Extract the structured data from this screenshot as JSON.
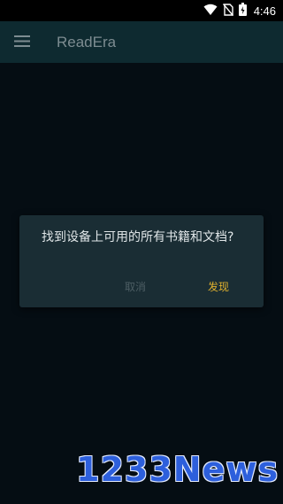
{
  "status_bar": {
    "time": "4:46",
    "icons": [
      "wifi-icon",
      "no-sim-icon",
      "battery-icon"
    ]
  },
  "app_bar": {
    "menu_icon": "hamburger-menu-icon",
    "title": "ReadEra"
  },
  "dialog": {
    "message": "找到设备上可用的所有书籍和文档?",
    "cancel_label": "取消",
    "confirm_label": "发现"
  },
  "watermark": {
    "text": "1233News"
  },
  "colors": {
    "background": "#050d13",
    "app_bar": "#0e2a30",
    "dialog": "#1a2d34",
    "accent": "#e0b12e",
    "cancel_disabled": "#4d5e64",
    "watermark": "#2d5fdc"
  }
}
